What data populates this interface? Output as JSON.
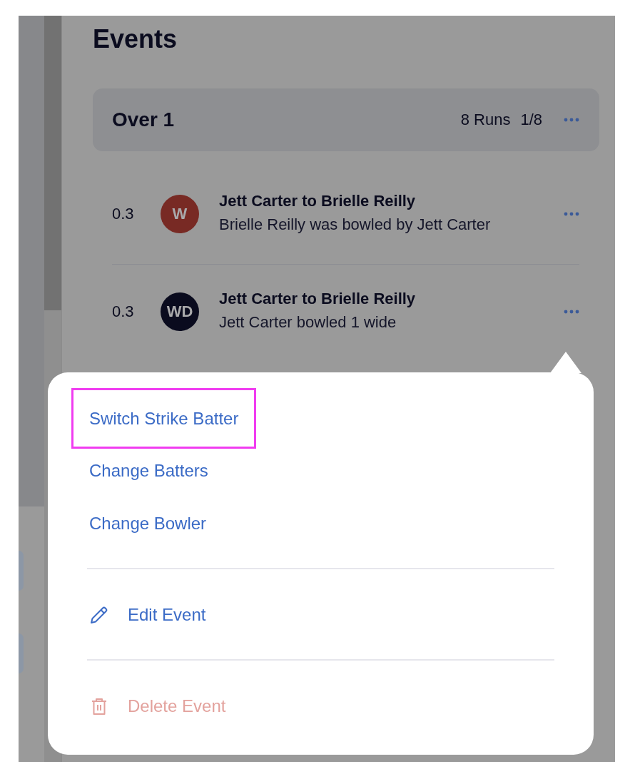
{
  "title": "Events",
  "over": {
    "label": "Over 1",
    "runs": "8 Runs",
    "score": "1/8"
  },
  "events": [
    {
      "ball": "0.3",
      "badge": "W",
      "color": "#782a24",
      "title": "Jett Carter to Brielle Reilly",
      "description": "Brielle Reilly was bowled by Jett Carter"
    },
    {
      "ball": "0.3",
      "badge": "WD",
      "color": "#0a0b1e",
      "title": "Jett Carter to Brielle Reilly",
      "description": "Jett Carter bowled 1 wide"
    }
  ],
  "menu": {
    "sections": [
      {
        "items": [
          {
            "label": "Switch Strike Batter",
            "kind": "plain",
            "selected": true
          },
          {
            "label": "Change Batters",
            "kind": "plain",
            "selected": false
          },
          {
            "label": "Change Bowler",
            "kind": "plain",
            "selected": false
          }
        ]
      },
      {
        "items": [
          {
            "label": "Edit Event",
            "kind": "edit",
            "selected": false
          }
        ]
      },
      {
        "items": [
          {
            "label": "Delete Event",
            "kind": "delete",
            "selected": false
          }
        ]
      }
    ]
  }
}
